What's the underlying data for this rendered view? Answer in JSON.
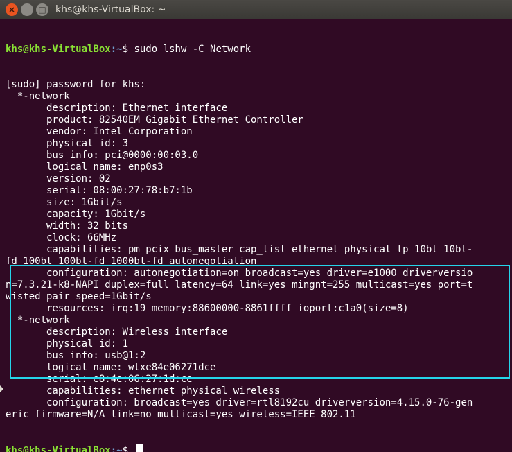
{
  "window": {
    "title": "khs@khs-VirtualBox: ~"
  },
  "terminal": {
    "prompt_user": "khs@khs-VirtualBox",
    "prompt_path": ":~",
    "prompt_sep": "$ ",
    "command": "sudo lshw -C Network",
    "lines": [
      "[sudo] password for khs:",
      "  *-network",
      "       description: Ethernet interface",
      "       product: 82540EM Gigabit Ethernet Controller",
      "       vendor: Intel Corporation",
      "       physical id: 3",
      "       bus info: pci@0000:00:03.0",
      "       logical name: enp0s3",
      "       version: 02",
      "       serial: 08:00:27:78:b7:1b",
      "       size: 1Gbit/s",
      "       capacity: 1Gbit/s",
      "       width: 32 bits",
      "       clock: 66MHz",
      "       capabilities: pm pcix bus_master cap_list ethernet physical tp 10bt 10bt-",
      "fd 100bt 100bt-fd 1000bt-fd autonegotiation",
      "       configuration: autonegotiation=on broadcast=yes driver=e1000 driverversio",
      "n=7.3.21-k8-NAPI duplex=full latency=64 link=yes mingnt=255 multicast=yes port=t",
      "wisted pair speed=1Gbit/s",
      "       resources: irq:19 memory:88600000-8861ffff ioport:c1a0(size=8)",
      "  *-network",
      "       description: Wireless interface",
      "       physical id: 1",
      "       bus info: usb@1:2",
      "       logical name: wlxe84e06271dce",
      "       serial: e8:4e:06:27:1d:ce",
      "       capabilities: ethernet physical wireless",
      "       configuration: broadcast=yes driver=rtl8192cu driverversion=4.15.0-76-gen",
      "eric firmware=N/A link=no multicast=yes wireless=IEEE 802.11"
    ]
  },
  "icons": {
    "close": "close-icon",
    "minimize": "minimize-icon",
    "maximize": "maximize-icon"
  },
  "colors": {
    "background": "#300a24",
    "prompt_user": "#8ae234",
    "prompt_path": "#729fcf",
    "highlight": "#25d4ea"
  }
}
